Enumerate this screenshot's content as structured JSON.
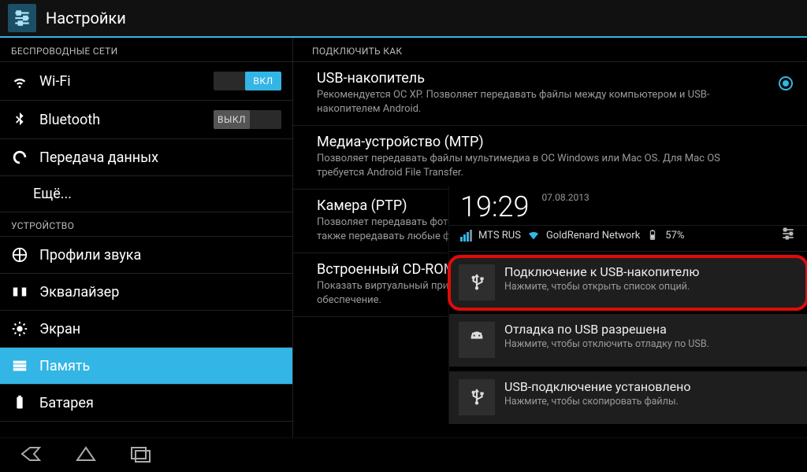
{
  "header": {
    "title": "Настройки"
  },
  "sidebar": {
    "section_wireless": "БЕСПРОВОДНЫЕ СЕТИ",
    "section_device": "УСТРОЙСТВО",
    "items": {
      "wifi": {
        "label": "Wi-Fi",
        "toggle": "ВКЛ"
      },
      "bluetooth": {
        "label": "Bluetooth",
        "toggle": "ВЫКЛ"
      },
      "datausage": {
        "label": "Передача данных"
      },
      "more": {
        "label": "Ещё..."
      },
      "sound": {
        "label": "Профили звука"
      },
      "equalizer": {
        "label": "Эквалайзер"
      },
      "display": {
        "label": "Экран"
      },
      "storage": {
        "label": "Память"
      },
      "battery": {
        "label": "Батарея"
      }
    }
  },
  "content": {
    "section": "ПОДКЛЮЧИТЬ КАК",
    "options": {
      "mass": {
        "title": "USB-накопитель",
        "desc": "Рекомендуется ОС XP. Позволяет передавать файлы между компьютером и USB-накопителем Android."
      },
      "mtp": {
        "title": "Медиа-устройство (MTP)",
        "desc": "Позволяет передавать файлы мультимедиа в ОС Windows или Mac OS. Для Mac OS требуется Android File Transfer."
      },
      "ptp": {
        "title": "Камера (PTP)",
        "desc": "Позволяет передавать фотографии с помощью программного обеспечения камеры, а также передавать любые файлы на компьютеры, которые не поддерживают MTP"
      },
      "cdrom": {
        "title": "Встроенный CD-ROM",
        "desc": "Показать виртуальный привод CD-ROM, содержащий полезное программное обеспечение."
      }
    }
  },
  "shade": {
    "time": "19:29",
    "date": "07.08.2013",
    "carrier": "MTS RUS",
    "wifi_network": "GoldRenard Network",
    "battery_pct": "57%",
    "notifications": {
      "usb_storage": {
        "title": "Подключение к USB-накопителю",
        "desc": "Нажмите, чтобы открыть список опций."
      },
      "adb": {
        "title": "Отладка по USB разрешена",
        "desc": "Нажмите, чтобы отключить отладку по USB."
      },
      "usb_conn": {
        "title": "USB-подключение установлено",
        "desc": "Нажмите, чтобы скопировать файлы."
      }
    }
  }
}
